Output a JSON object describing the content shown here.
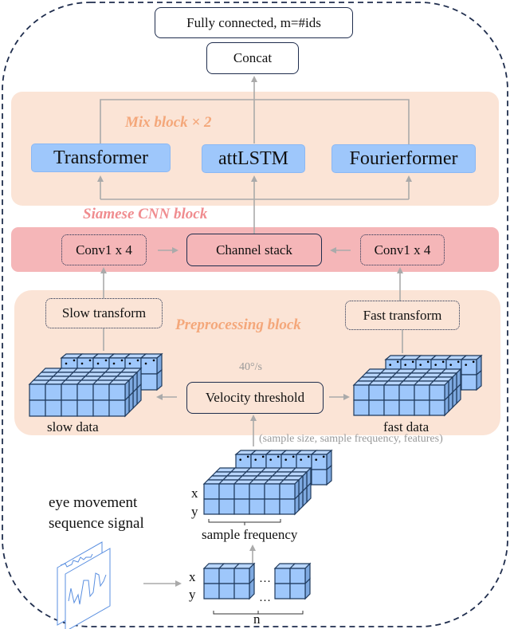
{
  "colors": {
    "outer_border": "#1f2d4d",
    "mix_block_bg": "#fbe4d6",
    "siamese_block_bg": "#f5b6b8",
    "preprocessing_block_bg": "#fbe4d6",
    "model_box_bg": "#9ec7fb",
    "mix_label": "#f4a77a",
    "siamese_label": "#f08c8f",
    "preprocessing_label": "#f4a77a",
    "arrow": "#aaaaaa",
    "cube_face": "#9ec7fb",
    "cube_edge": "#1f3a5c"
  },
  "top": {
    "fully_connected": "Fully connected, m=#ids",
    "concat": "Concat"
  },
  "mix_block": {
    "label": "Mix block × 2",
    "models": [
      "Transformer",
      "attLSTM",
      "Fourierformer"
    ]
  },
  "siamese_block": {
    "label": "Siamese CNN block",
    "left_conv": "Conv1 x 4",
    "channel_stack": "Channel stack",
    "right_conv": "Conv1 x 4"
  },
  "preprocessing_block": {
    "label": "Preprocessing block",
    "slow_transform": "Slow transform",
    "fast_transform": "Fast transform",
    "velocity_threshold": "Velocity threshold",
    "threshold_value": "40°/s",
    "slow_data": "slow data",
    "fast_data": "fast data"
  },
  "input": {
    "shape_annotation": "(sample size, sample frequency, features)",
    "x_label": "x",
    "y_label": "y",
    "sample_frequency": "sample frequency",
    "signal_label_line1": "eye movement",
    "signal_label_line2": "sequence signal",
    "ellipsis": "…",
    "n_label": "n"
  }
}
